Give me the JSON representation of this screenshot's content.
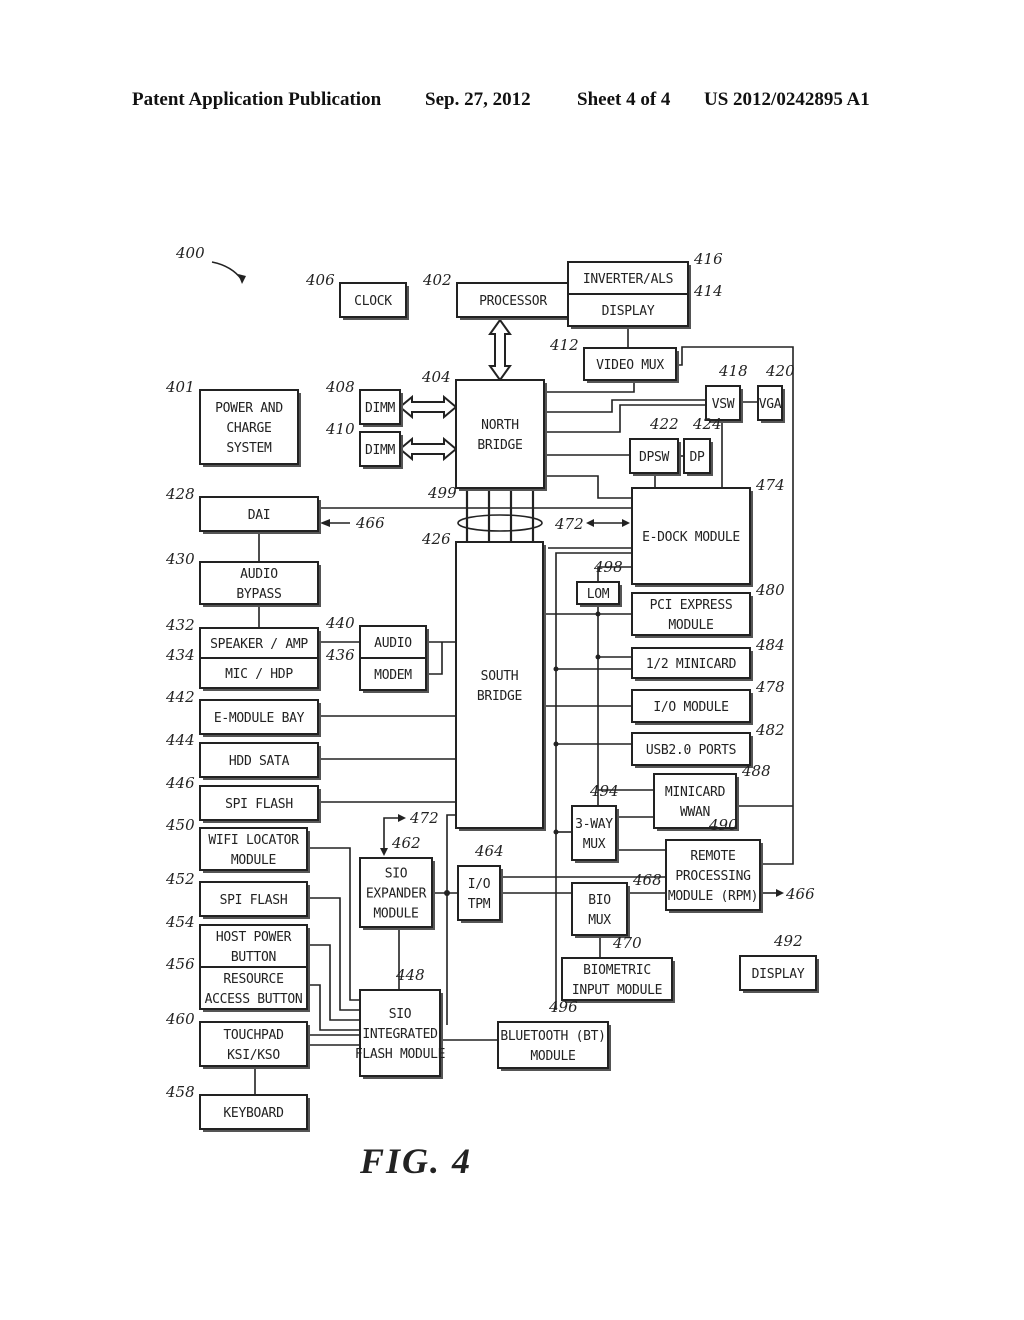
{
  "header": {
    "publication": "Patent Application Publication",
    "date": "Sep. 27, 2012",
    "sheet": "Sheet 4 of 4",
    "number": "US 2012/0242895 A1"
  },
  "figure": {
    "caption": "FIG. 4",
    "ref": "400"
  },
  "blocks": {
    "clock": {
      "ref": "406",
      "lines": [
        "CLOCK"
      ]
    },
    "processor": {
      "ref": "402",
      "lines": [
        "PROCESSOR"
      ]
    },
    "inverter": {
      "ref": "416",
      "lines": [
        "INVERTER/ALS"
      ]
    },
    "display_top": {
      "ref": "414",
      "lines": [
        "DISPLAY"
      ]
    },
    "video_mux": {
      "ref": "412",
      "lines": [
        "VIDEO MUX"
      ]
    },
    "vsw": {
      "ref": "418",
      "lines": [
        "VSW"
      ]
    },
    "vga": {
      "ref": "420",
      "lines": [
        "VGA"
      ]
    },
    "dpsw": {
      "ref": "422",
      "lines": [
        "DPSW"
      ]
    },
    "dp": {
      "ref": "424",
      "lines": [
        "DP"
      ]
    },
    "power": {
      "ref": "401",
      "lines": [
        "POWER AND",
        "CHARGE",
        "SYSTEM"
      ]
    },
    "dimm1": {
      "ref": "408",
      "lines": [
        "DIMM"
      ]
    },
    "dimm2": {
      "ref": "410",
      "lines": [
        "DIMM"
      ]
    },
    "north_bridge": {
      "ref": "404",
      "lines": [
        "NORTH",
        "BRIDGE"
      ]
    },
    "dai": {
      "ref": "428",
      "lines": [
        "DAI"
      ]
    },
    "audio_bypass": {
      "ref": "430",
      "lines": [
        "AUDIO",
        "BYPASS"
      ]
    },
    "speaker": {
      "ref": "432",
      "lines": [
        "SPEAKER / AMP"
      ]
    },
    "mic": {
      "ref": "434",
      "lines": [
        "MIC / HDP"
      ]
    },
    "audio": {
      "ref": "440",
      "lines": [
        "AUDIO"
      ]
    },
    "modem": {
      "ref": "436",
      "lines": [
        "MODEM"
      ]
    },
    "e_module_bay": {
      "ref": "442",
      "lines": [
        "E-MODULE BAY"
      ]
    },
    "hdd_sata": {
      "ref": "444",
      "lines": [
        "HDD SATA"
      ]
    },
    "spi_flash1": {
      "ref": "446",
      "lines": [
        "SPI FLASH"
      ]
    },
    "wifi": {
      "ref": "450",
      "lines": [
        "WIFI LOCATOR",
        "MODULE"
      ]
    },
    "spi_flash2": {
      "ref": "452",
      "lines": [
        "SPI FLASH"
      ]
    },
    "host_power": {
      "ref": "454",
      "lines": [
        "HOST POWER",
        "BUTTON"
      ]
    },
    "resource": {
      "ref": "456",
      "lines": [
        "RESOURCE",
        "ACCESS BUTTON"
      ]
    },
    "touchpad": {
      "ref": "460",
      "lines": [
        "TOUCHPAD",
        "KSI/KSO"
      ]
    },
    "keyboard": {
      "ref": "458",
      "lines": [
        "KEYBOARD"
      ]
    },
    "south_bridge": {
      "ref": "426",
      "lines": [
        "SOUTH",
        "BRIDGE"
      ]
    },
    "edock": {
      "ref": "474",
      "lines": [
        "E-DOCK MODULE"
      ]
    },
    "lom": {
      "ref": "498",
      "lines": [
        "LOM"
      ]
    },
    "pci": {
      "ref": "480",
      "lines": [
        "PCI EXPRESS",
        "MODULE"
      ]
    },
    "minicard_half": {
      "ref": "484",
      "lines": [
        "1/2 MINICARD"
      ]
    },
    "io_module": {
      "ref": "478",
      "lines": [
        "I/O MODULE"
      ]
    },
    "usb": {
      "ref": "482",
      "lines": [
        "USB2.0 PORTS"
      ]
    },
    "minicard_wwan": {
      "ref": "488",
      "lines": [
        "MINICARD",
        "WWAN"
      ]
    },
    "three_way": {
      "ref": "494",
      "lines": [
        "3-WAY",
        "MUX"
      ]
    },
    "rpm": {
      "ref": "490",
      "lines": [
        "REMOTE",
        "PROCESSING",
        "MODULE (RPM)"
      ]
    },
    "sio_expander": {
      "ref": "462",
      "lines": [
        "SIO",
        "EXPANDER",
        "MODULE"
      ]
    },
    "io_tpm": {
      "ref": "464",
      "lines": [
        "I/O",
        "TPM"
      ]
    },
    "bio_mux": {
      "ref": "468",
      "lines": [
        "BIO",
        "MUX"
      ]
    },
    "biometric": {
      "ref": "470",
      "lines": [
        "BIOMETRIC",
        "INPUT MODULE"
      ]
    },
    "display_492": {
      "ref": "492",
      "lines": [
        "DISPLAY"
      ]
    },
    "sio_flash": {
      "ref": "448",
      "lines": [
        "SIO",
        "INTEGRATED",
        "FLASH MODULE"
      ]
    },
    "bluetooth": {
      "ref": "496",
      "lines": [
        "BLUETOOTH (BT)",
        "MODULE"
      ]
    }
  },
  "annotations": {
    "bus": "499",
    "edock_link": "472",
    "sio_link": "472",
    "dai_input": "466",
    "rpm_output": "466"
  }
}
